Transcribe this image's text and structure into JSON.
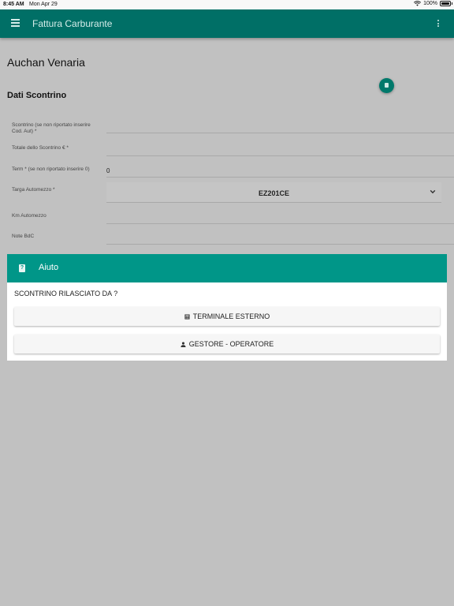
{
  "status_bar": {
    "time": "8:45 AM",
    "date": "Mon Apr 29",
    "battery": "100%"
  },
  "app_bar": {
    "title": "Fattura Carburante",
    "icons": [
      "menu-icon",
      "more-vert-icon"
    ]
  },
  "station_name": "Auchan Venaria",
  "section_title": "Dati Scontrino",
  "form": {
    "scontrino": {
      "label_line1": "Scontrino (se non riportato inserire",
      "label_line2": "Cod. Aut) *",
      "value": ""
    },
    "totale": {
      "label": "Totale dello Scontrino € *",
      "value": ""
    },
    "term": {
      "label": "Term * (se non riportato inserire 0)",
      "value": "0"
    },
    "targa": {
      "label": "Targa Automezzo *",
      "selected": "EZ201CE"
    },
    "km": {
      "label": "Km Automezzo",
      "value": ""
    },
    "note": {
      "label": "Note BdC",
      "value": ""
    }
  },
  "dialog": {
    "title": "Aiuto",
    "question": "SCONTRINO RILASCIATO DA ?",
    "buttons": [
      {
        "label": "TERMINALE ESTERNO",
        "icon": "calculator-icon"
      },
      {
        "label": "GESTORE - OPERATORE",
        "icon": "person-icon"
      }
    ]
  },
  "colors": {
    "app_bar": "#006f66",
    "dialog_header": "#009688",
    "overlay": "#c1c1c1"
  }
}
